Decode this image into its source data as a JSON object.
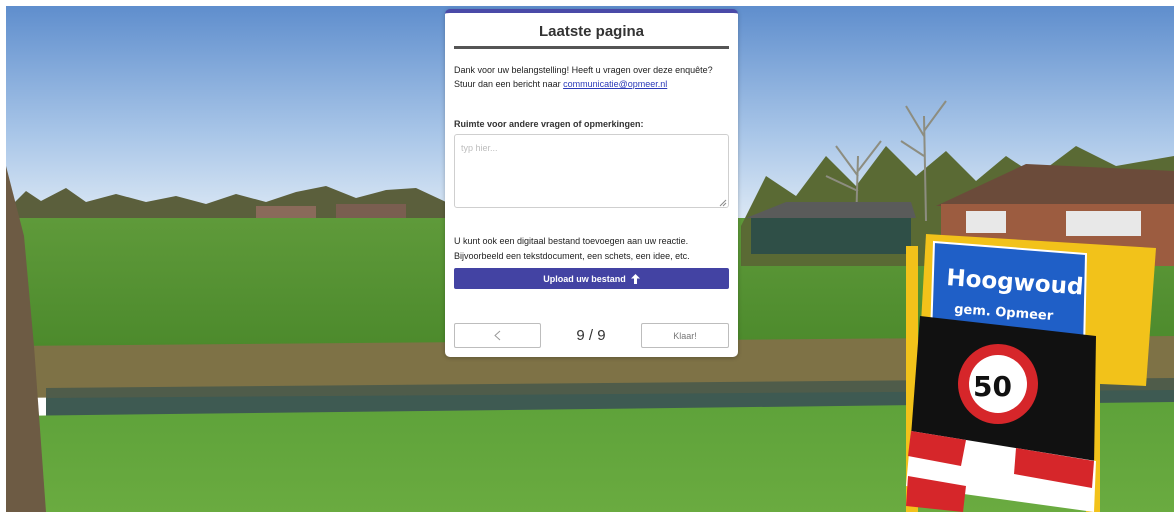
{
  "scene": {
    "sign_place_name": "Hoogwoud",
    "sign_municipality": "gem. Opmeer",
    "speed_limit": "50"
  },
  "survey": {
    "title": "Laatste pagina",
    "intro_text": "Dank voor uw belangstelling! Heeft u vragen over deze enquête? Stuur dan een bericht naar ",
    "contact_email": "communicatie@opmeer.nl",
    "question_label": "Ruimte voor andere vragen of opmerkingen:",
    "remarks_value": "",
    "remarks_placeholder": "typ hier...",
    "upload_text": "U kunt ook een digitaal bestand toevoegen aan uw reactie. Bijvoorbeeld een tekstdocument, een schets, een idee, etc.",
    "upload_button_label": "Upload uw bestand",
    "upload_icon": "arrow-up-icon",
    "prev_icon": "chevron-left-icon",
    "page_indicator": "9 / 9",
    "done_button_label": "Klaar!"
  },
  "colors": {
    "accent": "#4343a3",
    "link": "#2b3ab8",
    "sign_blue": "#1f5fc7",
    "sign_yellow": "#f2c21a",
    "sign_red": "#d6262a"
  }
}
